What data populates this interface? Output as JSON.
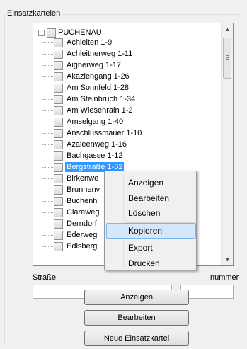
{
  "group_title": "Einsatzkarteien",
  "tree": {
    "root": "PUCHENAU",
    "items": [
      "Achleiten 1-9",
      "Achleitnerweg 1-11",
      "Aignerweg 1-17",
      "Akaziengang 1-26",
      "Am Sonnfeld 1-28",
      "Am Steinbruch 1-34",
      "Am Wiesenrain 1-2",
      "Amselgang 1-40",
      "Anschlussmauer 1-10",
      "Azaleenweg 1-16",
      "Bachgasse 1-12",
      "Bergstraße 1-52",
      "Birkenwe",
      "Brunnenv",
      "Buchenh",
      "Claraweg",
      "Derndorf",
      "Ederweg",
      "Edlsberg"
    ],
    "selected_index": 11
  },
  "fields": {
    "strasse_label": "Straße",
    "nummer_label": "nummer",
    "strasse_value": "",
    "nummer_value": ""
  },
  "buttons": {
    "anzeigen": "Anzeigen",
    "bearbeiten": "Bearbeiten",
    "neue": "Neue Einsatzkartei"
  },
  "context_menu": {
    "items": [
      "Anzeigen",
      "Bearbeiten",
      "Löschen",
      "Kopieren",
      "Export",
      "Drucken"
    ],
    "highlighted": "Kopieren"
  }
}
